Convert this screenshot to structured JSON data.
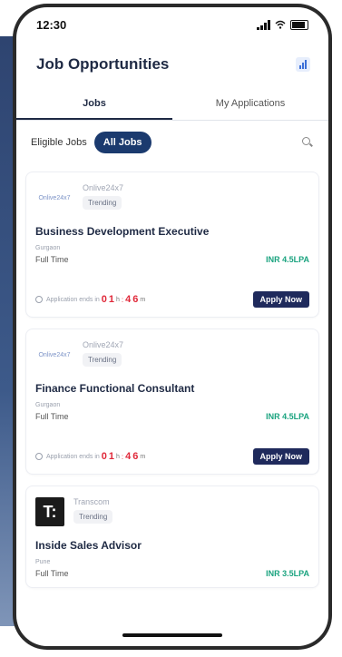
{
  "status": {
    "time": "12:30"
  },
  "app": {
    "title": "Job Opportunities"
  },
  "tabs": [
    {
      "label": "Jobs"
    },
    {
      "label": "My Applications"
    }
  ],
  "filters": [
    {
      "label": "Eligible Jobs"
    },
    {
      "label": "All Jobs"
    }
  ],
  "jobs": [
    {
      "company": "Onlive24x7",
      "badge": "Trending",
      "title": "Business Development Executive",
      "location": "Gurgaon",
      "type": "Full Time",
      "salary": "INR 4.5LPA",
      "deadline_label": "Application ends in",
      "t1": "0",
      "t2": "1",
      "unit1": "h",
      "t3": "4",
      "t4": "6",
      "unit2": "m",
      "apply": "Apply Now"
    },
    {
      "company": "Onlive24x7",
      "badge": "Trending",
      "title": "Finance Functional Consultant",
      "location": "Gurgaon",
      "type": "Full Time",
      "salary": "INR 4.5LPA",
      "deadline_label": "Application ends in",
      "t1": "0",
      "t2": "1",
      "unit1": "h",
      "t3": "4",
      "t4": "6",
      "unit2": "m",
      "apply": "Apply Now"
    },
    {
      "company": "Transcom",
      "badge": "Trending",
      "title": "Inside Sales Advisor",
      "location": "Pune",
      "type": "Full Time",
      "salary": "INR 3.5LPA",
      "logo_text": "T:"
    }
  ],
  "logo_text": "Onlive24x7",
  "colors": {
    "primary": "#1b3a6e",
    "salary": "#1aa37f",
    "timer": "#e0293a"
  }
}
